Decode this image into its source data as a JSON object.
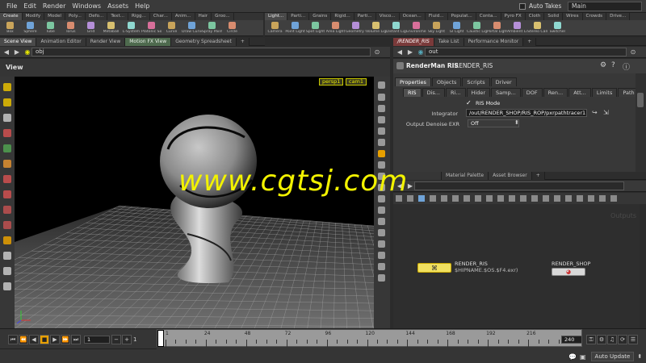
{
  "menubar": {
    "items": [
      "File",
      "Edit",
      "Render",
      "Windows",
      "Assets",
      "Help"
    ],
    "auto_takes": "Auto Takes",
    "desktop": "Main"
  },
  "shelf_left": {
    "tabs": [
      "Create",
      "Modify",
      "Model",
      "Poly...",
      "Defo...",
      "Text...",
      "Rigg...",
      "Char...",
      "Anim...",
      "Hair",
      "Groo..."
    ],
    "tools": [
      "Box",
      "Sphere",
      "Tube",
      "Torus",
      "Grid",
      "Metaball",
      "L-System",
      "Platonic Sol...",
      "Curve",
      "Draw Curve",
      "Spray Paint",
      "Circle"
    ]
  },
  "shelf_right": {
    "tabs": [
      "Light...",
      "Parti...",
      "Grains",
      "Rigid...",
      "Parti...",
      "Visco...",
      "Ocean...",
      "Fluid...",
      "Populat...",
      "Conta...",
      "Pyro FX",
      "Cloth",
      "Solid",
      "Wires",
      "Crowds",
      "Drive..."
    ],
    "tools": [
      "Camera",
      "Point Light",
      "Spot Light",
      "Area Light",
      "Geometry L...",
      "Volume Light",
      "Distant Light",
      "Environme...",
      "Sky Light",
      "GI Light",
      "Caustic Light",
      "Portal Light",
      "Ambient Li...",
      "Stereo Cam...",
      "Switcher"
    ]
  },
  "left_pane": {
    "tabs": [
      "Scene View",
      "Animation Editor",
      "Render View",
      "Motion FX View",
      "Geometry Spreadsheet"
    ],
    "path": "obj",
    "view_label": "View",
    "persp": "persp1",
    "cam": "cam1"
  },
  "right_top": {
    "tabs": [
      "/RENDER_RIS",
      "Take List",
      "Performance Monitor"
    ],
    "path": "out",
    "node_type": "RenderMan RIS",
    "node_name": "RENDER_RIS",
    "param_tabs": [
      "Properties",
      "Objects",
      "Scripts",
      "Driver"
    ],
    "sub_tabs": [
      "RIS",
      "Dis...",
      "Ri...",
      "Hider",
      "Samp...",
      "DOF",
      "Ren...",
      "Att...",
      "Limits",
      "Path"
    ],
    "ris_mode": "RIS Mode",
    "integrator_label": "Integrator",
    "integrator_value": "/out/RENDER_SHOP/RIS_ROP/pxrpathtracer1",
    "denoise_label": "Output Denoise EXR",
    "denoise_value": "Off"
  },
  "network": {
    "tabs": [
      "Material Palette",
      "Asset Browser"
    ],
    "outputs_label": "Outputs",
    "node1_name": "RENDER_RIS",
    "node1_sub": "$HIPNAME.$OS.$F4.exr)",
    "node2_name": "RENDER_SHOP"
  },
  "watermark": "www.cgtsj.com",
  "timeline": {
    "frame": "1",
    "start": "1",
    "step": "1",
    "end": "240",
    "ticks": [
      "1",
      "24",
      "48",
      "72",
      "96",
      "120",
      "144",
      "168",
      "192",
      "216"
    ],
    "auto_update": "Auto Update"
  },
  "colors": {
    "accent_yellow": "#e8e800",
    "node_yellow": "#f0e060",
    "selected_tab": "#4e6a4e",
    "red_tab": "#7a3a3a"
  }
}
